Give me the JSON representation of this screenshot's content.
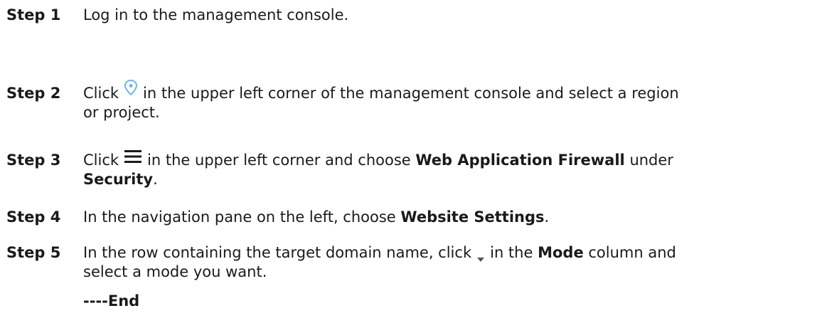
{
  "steps": [
    {
      "label": "Step 1",
      "text": "Log in to the management console."
    },
    {
      "label": "Step 2",
      "pre": "Click",
      "icon": "location-pin-icon",
      "post": "in the upper left corner of the management console and select a region",
      "line2": "or project."
    },
    {
      "label": "Step 3",
      "pre": "Click",
      "icon": "hamburger-menu-icon",
      "mid": "in the upper left corner and choose",
      "bold1": "Web Application Firewall",
      "mid2": "under",
      "bold2": "Security",
      "end": "."
    },
    {
      "label": "Step 4",
      "pre": "In the navigation pane on the left, choose",
      "bold": "Website Settings",
      "end": "."
    },
    {
      "label": "Step 5",
      "pre": "In the row containing the target domain name, click",
      "icon": "dropdown-caret-icon",
      "mid": "in the",
      "bold": "Mode",
      "post": "column and",
      "line2": "select a mode you want."
    }
  ],
  "end_marker": "----End",
  "colors": {
    "text": "#1a1a1a",
    "pin_icon": "#6fb7e6",
    "menu_icon": "#1a1a1a",
    "caret_icon": "#555555"
  }
}
